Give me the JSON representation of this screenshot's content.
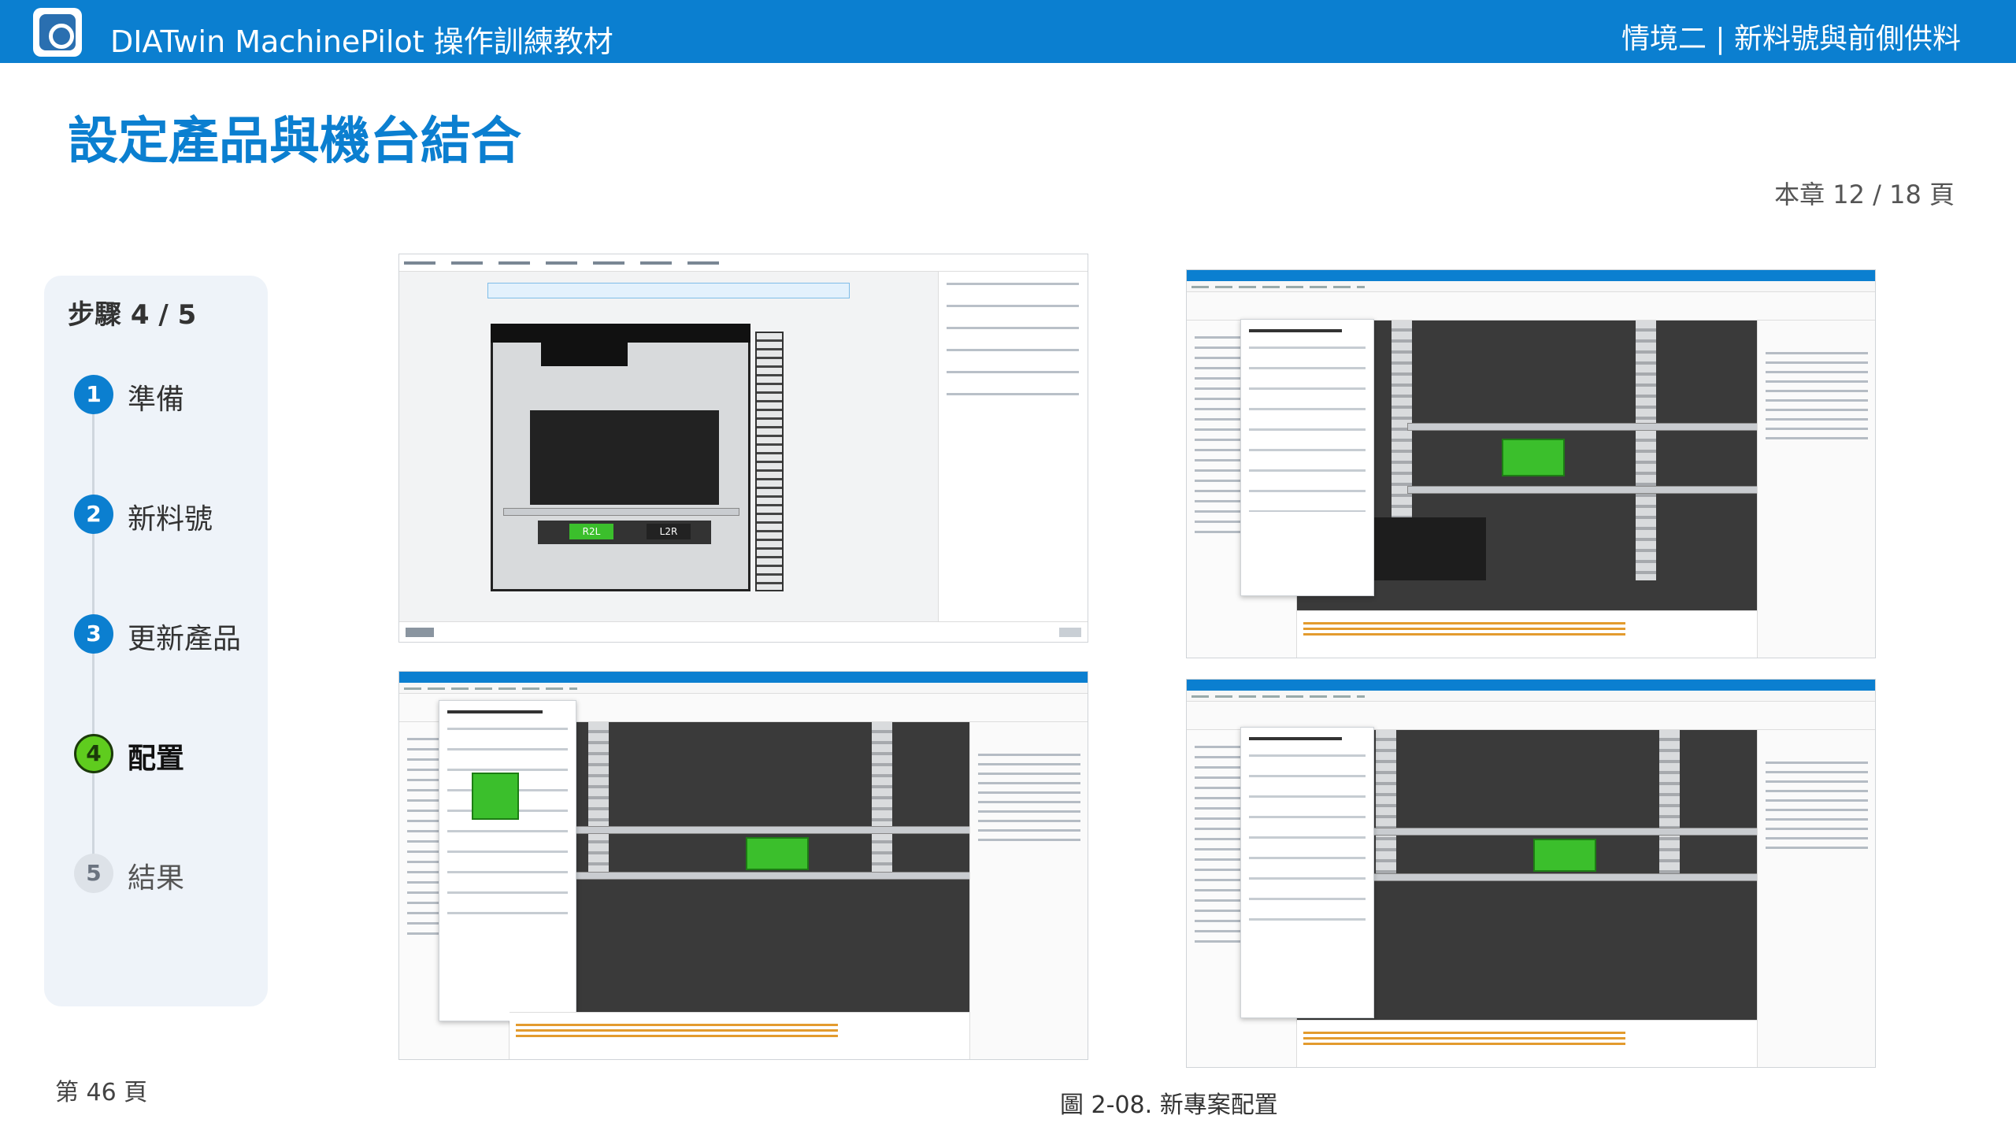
{
  "header": {
    "brand": "DIATwin MachinePilot 操作訓練教材",
    "chapter": "情境二 | 新料號與前側供料"
  },
  "page_title": "設定產品與機台結合",
  "chapter_page": "本章 12 / 18 頁",
  "steps_panel": {
    "title": "步驟 4 / 5",
    "items": [
      {
        "num": "1",
        "label": "準備"
      },
      {
        "num": "2",
        "label": "新料號"
      },
      {
        "num": "3",
        "label": "更新產品"
      },
      {
        "num": "4",
        "label": "配置"
      },
      {
        "num": "5",
        "label": "結果"
      }
    ]
  },
  "screenshots": {
    "first": {
      "left_label": "R2L",
      "right_label": "L2R"
    }
  },
  "footer": {
    "page": "第 46 頁",
    "caption": "圖 2-08. 新專案配置"
  },
  "colors": {
    "brand_blue": "#0b7fd0",
    "current_step_green": "#5fcc1e",
    "pcb_green": "#3bbf2c"
  }
}
